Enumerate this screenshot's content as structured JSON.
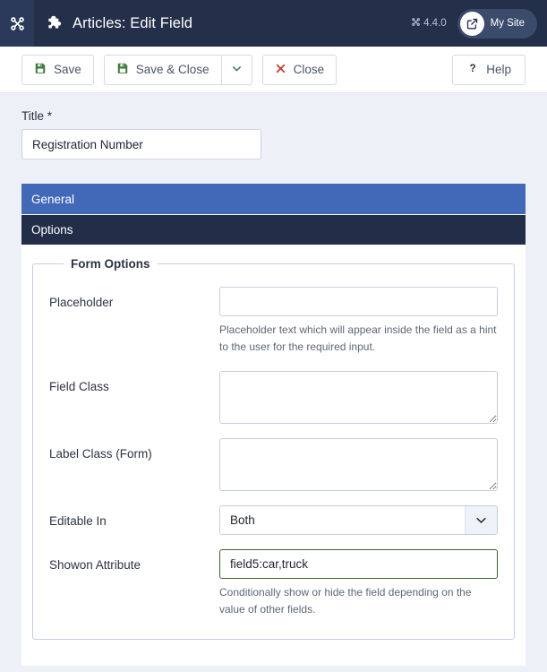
{
  "header": {
    "logo_icon": "joomla-logo-icon",
    "title_icon": "puzzle-piece-icon",
    "title": "Articles: Edit Field",
    "version_icon": "joomla-mark-icon",
    "version": "4.4.0",
    "mysite_icon": "external-link-icon",
    "mysite_label": "My Site"
  },
  "toolbar": {
    "save_label": "Save",
    "save_icon": "save-floppy-icon",
    "save_close_label": "Save & Close",
    "save_close_icon": "save-floppy-icon",
    "caret_icon": "chevron-down-icon",
    "close_label": "Close",
    "close_icon": "x-mark-icon",
    "help_label": "Help",
    "help_icon": "question-mark-icon"
  },
  "colors": {
    "header_bg": "#243049",
    "logo_bg": "#2b395a",
    "tab_active": "#4169b8",
    "tab_inactive": "#222e47",
    "page_bg": "#edf0f7",
    "save_icon_green": "#3e7a3e",
    "close_icon_red": "#c0392b",
    "valid_border_green": "#3f6133"
  },
  "form": {
    "title_label": "Title *",
    "title_value": "Registration Number",
    "title_placeholder": ""
  },
  "tabs": [
    {
      "label": "General",
      "active": true
    },
    {
      "label": "Options",
      "active": false
    }
  ],
  "fieldset": {
    "legend": "Form Options",
    "rows": [
      {
        "label": "Placeholder",
        "control": "input",
        "value": "",
        "placeholder": "",
        "hint": "Placeholder text which will appear inside the field as a hint to the user for the required input."
      },
      {
        "label": "Field Class",
        "control": "textarea",
        "value": "",
        "placeholder": "",
        "hint": ""
      },
      {
        "label": "Label Class (Form)",
        "control": "textarea",
        "value": "",
        "placeholder": "",
        "hint": ""
      },
      {
        "label": "Editable In",
        "control": "select",
        "value": "Both",
        "caret_icon": "chevron-down-icon",
        "hint": ""
      },
      {
        "label": "Showon Attribute",
        "control": "input",
        "value": "field5:car,truck",
        "placeholder": "",
        "valid": true,
        "hint": "Conditionally show or hide the field depending on the value of other fields."
      }
    ]
  }
}
